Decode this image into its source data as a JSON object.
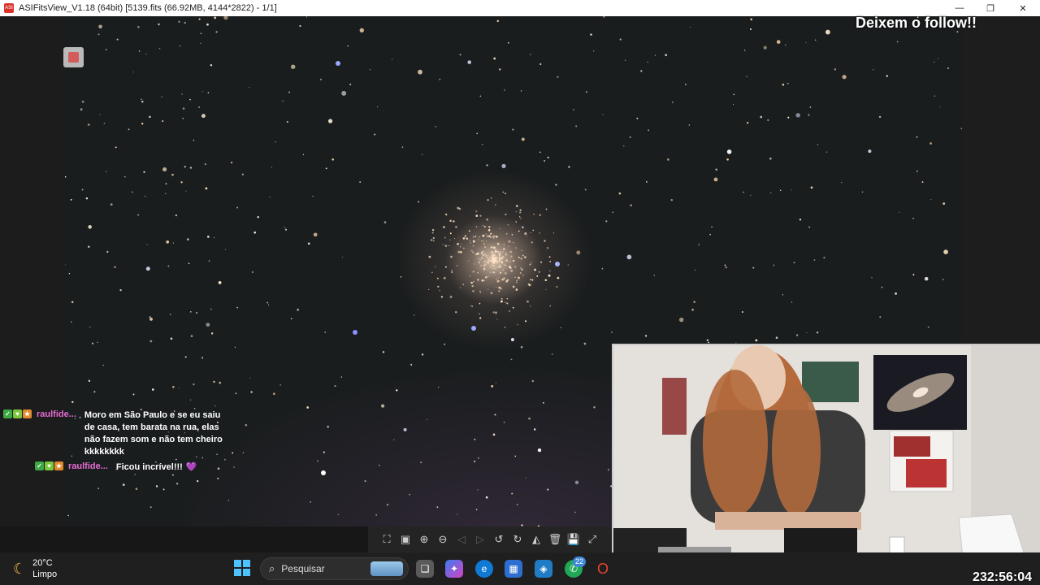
{
  "window": {
    "title": "ASIFitsView_V1.18 (64bit) [5139.fits (66.92MB, 4144*2822) - 1/1]",
    "minimize_icon": "minimize-icon",
    "restore_icon": "restore-icon",
    "close_icon": "close-icon",
    "app_icon_label": "ASI"
  },
  "overlay": {
    "follow_text": "Deixem o follow!!",
    "timer": "232:56:04"
  },
  "chat": {
    "messages": [
      {
        "user": "raulfide...",
        "text": "Moro em São Paulo e se eu saiu de casa, tem barata na rua, elas não fazem som e não tem cheiro kkkkkkkk"
      },
      {
        "user": "raulfide...",
        "text": "Ficou incrível!!!",
        "emote": "💜"
      }
    ]
  },
  "viewer_toolbar": {
    "icons": [
      "fit-window-icon",
      "actual-size-icon",
      "zoom-in-icon",
      "zoom-out-icon",
      "prev-icon",
      "next-icon",
      "rotate-left-icon",
      "rotate-right-icon",
      "histogram-icon",
      "delete-icon",
      "save-icon",
      "fullscreen-icon"
    ]
  },
  "taskbar": {
    "weather_temp": "20°C",
    "weather_desc": "Limpo",
    "search_placeholder": "Pesquisar",
    "whatsapp_badge": "22"
  },
  "colors": {
    "accent_blue": "#4cc2ff",
    "chat_username": "#e56bd4",
    "sky": "#1a1d1e"
  }
}
